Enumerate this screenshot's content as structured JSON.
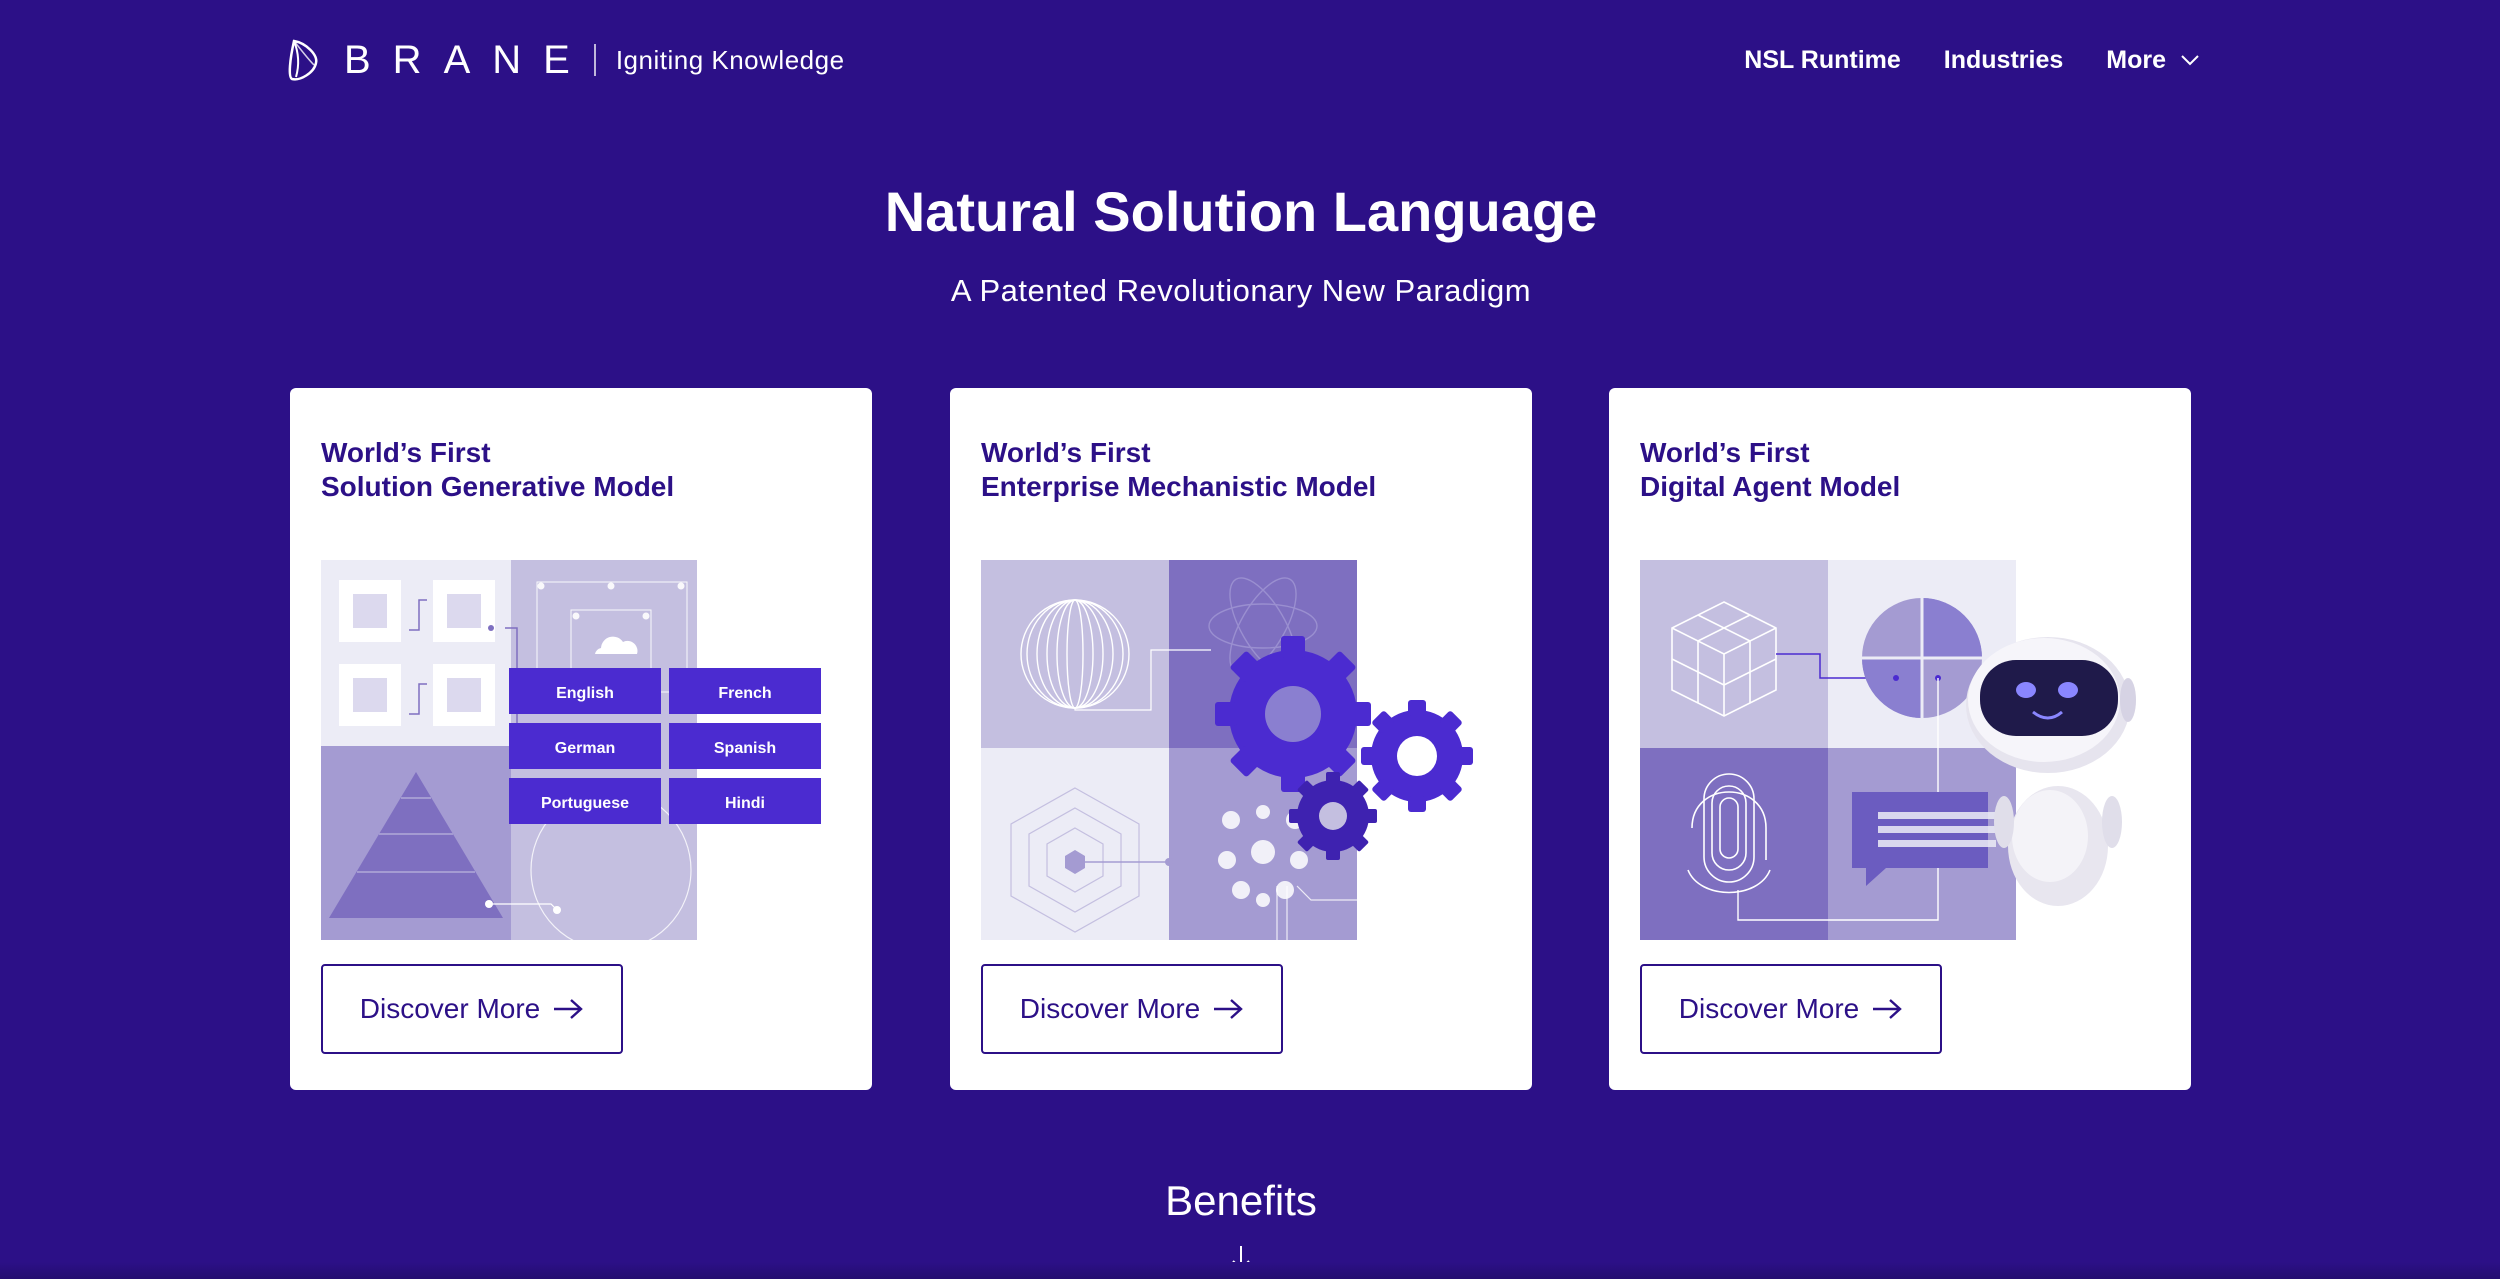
{
  "header": {
    "brand": "BRANE",
    "tagline": "Igniting Knowledge",
    "nav": [
      {
        "label": "NSL Runtime"
      },
      {
        "label": "Industries"
      },
      {
        "label": "More",
        "icon": "chevron-down-icon"
      }
    ]
  },
  "hero": {
    "title": "Natural Solution Language",
    "subtitle": "A Patented Revolutionary New Paradigm"
  },
  "cards": [
    {
      "title_line1": "World’s First",
      "title_line2": "Solution Generative Model",
      "languages": [
        "English",
        "French",
        "German",
        "Spanish",
        "Portuguese",
        "Hindi"
      ],
      "button_label": "Discover More"
    },
    {
      "title_line1": "World’s First",
      "title_line2": "Enterprise Mechanistic Model",
      "button_label": "Discover More"
    },
    {
      "title_line1": "World’s First",
      "title_line2": "Digital Agent Model",
      "button_label": "Discover More"
    }
  ],
  "benefits": {
    "label": "Benefits",
    "icon": "arrow-down-icon"
  },
  "colors": {
    "background": "#2c1087",
    "card": "#ffffff",
    "accent": "#4b2bd0",
    "tile_light": "#c4bfe0",
    "tile_mid": "#a49bd2",
    "tile_dark": "#7e6fc0"
  }
}
